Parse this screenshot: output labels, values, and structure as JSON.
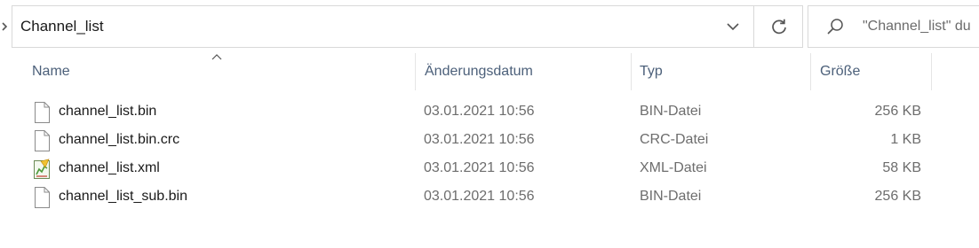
{
  "address_bar": {
    "path": "Channel_list"
  },
  "search": {
    "placeholder": "\"Channel_list\" du"
  },
  "columns": {
    "name": "Name",
    "date": "Änderungsdatum",
    "type": "Typ",
    "size": "Größe"
  },
  "files": [
    {
      "name": "channel_list.bin",
      "date": "03.01.2021 10:56",
      "type": "BIN-Datei",
      "size": "256 KB",
      "icon": "generic-file-icon"
    },
    {
      "name": "channel_list.bin.crc",
      "date": "03.01.2021 10:56",
      "type": "CRC-Datei",
      "size": "1 KB",
      "icon": "generic-file-icon"
    },
    {
      "name": "channel_list.xml",
      "date": "03.01.2021 10:56",
      "type": "XML-Datei",
      "size": "58 KB",
      "icon": "xml-file-icon"
    },
    {
      "name": "channel_list_sub.bin",
      "date": "03.01.2021 10:56",
      "type": "BIN-Datei",
      "size": "256 KB",
      "icon": "generic-file-icon"
    }
  ],
  "colors": {
    "header_text": "#4c607a",
    "border": "#d9d9d9",
    "secondary_text": "#6d6d6d"
  }
}
